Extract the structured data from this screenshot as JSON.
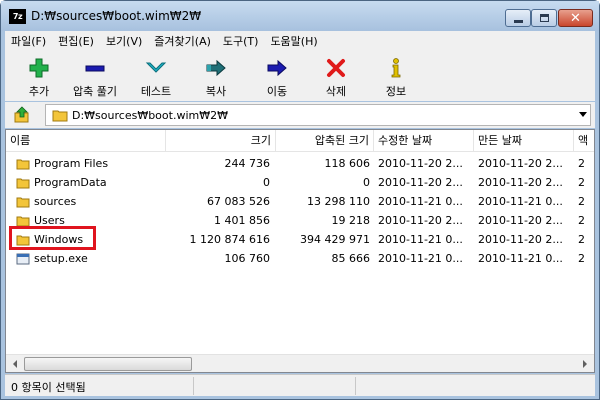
{
  "window": {
    "title": "D:₩sources₩boot.wim₩2₩",
    "app_icon_text": "7z"
  },
  "menu": [
    "파일(F)",
    "편집(E)",
    "보기(V)",
    "즐겨찾기(A)",
    "도구(T)",
    "도움말(H)"
  ],
  "toolbar": [
    {
      "label": "추가",
      "icon": "add-icon",
      "color": "#22b14c"
    },
    {
      "label": "압축 풀기",
      "icon": "extract-icon",
      "color": "#1b1bb0"
    },
    {
      "label": "테스트",
      "icon": "test-icon",
      "color": "#1fb5c8"
    },
    {
      "label": "복사",
      "icon": "copy-icon",
      "color": "#1f6f77"
    },
    {
      "label": "이동",
      "icon": "move-icon",
      "color": "#1b1bb0"
    },
    {
      "label": "삭제",
      "icon": "delete-icon",
      "color": "#e01a1a"
    },
    {
      "label": "정보",
      "icon": "info-icon",
      "color": "#e0c000"
    }
  ],
  "address": {
    "path": "D:₩sources₩boot.wim₩2₩"
  },
  "columns": [
    "이름",
    "크기",
    "압축된 크기",
    "수정한 날짜",
    "만든 날짜",
    "액"
  ],
  "files": [
    {
      "name": "Program Files",
      "type": "folder",
      "size": "244 736",
      "packed": "118 606",
      "modified": "2010-11-20 2...",
      "created": "2010-11-20 2...",
      "extra": "2"
    },
    {
      "name": "ProgramData",
      "type": "folder",
      "size": "0",
      "packed": "0",
      "modified": "2010-11-20 2...",
      "created": "2010-11-20 2...",
      "extra": "2"
    },
    {
      "name": "sources",
      "type": "folder",
      "size": "67 083 526",
      "packed": "13 298 110",
      "modified": "2010-11-21 0...",
      "created": "2010-11-21 0...",
      "extra": "2"
    },
    {
      "name": "Users",
      "type": "folder",
      "size": "1 401 856",
      "packed": "19 218",
      "modified": "2010-11-20 2...",
      "created": "2010-11-20 2...",
      "extra": "2"
    },
    {
      "name": "Windows",
      "type": "folder",
      "size": "1 120 874 616",
      "packed": "394 429 971",
      "modified": "2010-11-21 0...",
      "created": "2010-11-20 2...",
      "extra": "2"
    },
    {
      "name": "setup.exe",
      "type": "file",
      "size": "106 760",
      "packed": "85 666",
      "modified": "2010-11-21 0...",
      "created": "2010-11-21 0...",
      "extra": "2"
    }
  ],
  "status": {
    "text": "0 항목이 선택됨"
  },
  "colors": {
    "highlight": "#e0141e",
    "folder": "#f3c53a"
  }
}
